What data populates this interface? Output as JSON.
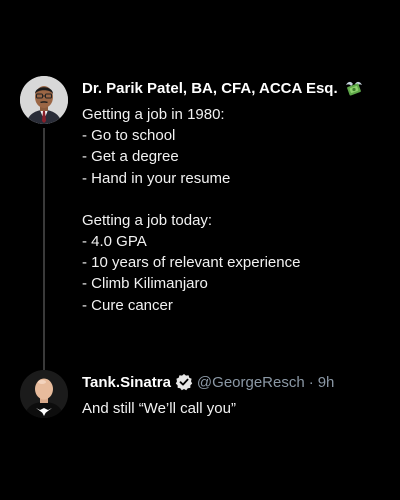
{
  "posts": [
    {
      "author": {
        "name": "Dr. Parik Patel, BA, CFA, ACCA Esq.",
        "badge_icon": "money-with-wings-icon"
      },
      "lines": [
        "Getting a job in 1980:",
        "- Go to school",
        "- Get a degree",
        "- Hand in your resume",
        "",
        "Getting a job today:",
        "- 4.0 GPA",
        "- 10 years of relevant experience",
        "- Climb Kilimanjaro",
        "- Cure cancer"
      ]
    },
    {
      "author": {
        "name": "Tank.Sinatra",
        "verified_icon": "verified-badge-icon",
        "handle": "@GeorgeResch",
        "separator": "·",
        "time": "9h"
      },
      "text": "And still “We’ll call you”"
    }
  ],
  "colors": {
    "background": "#000000",
    "text_primary": "#ffffff",
    "text_secondary": "#8b98a5",
    "thread_line": "#3a3a3a",
    "verified_blue": "#1d9bf0"
  }
}
